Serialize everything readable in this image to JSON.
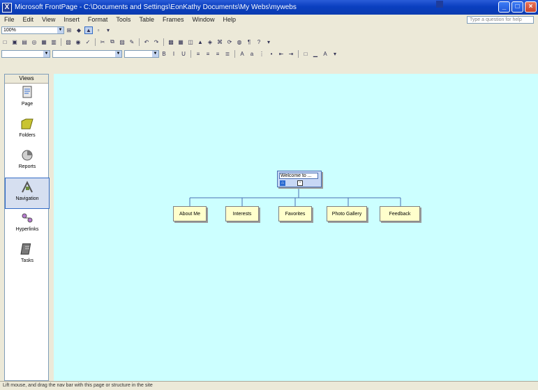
{
  "window": {
    "app_icon": "frontpage-icon",
    "title": "Microsoft FrontPage - C:\\Documents and Settings\\EonKathy Documents\\My Webs\\mywebs"
  },
  "menu": [
    "File",
    "Edit",
    "View",
    "Insert",
    "Format",
    "Tools",
    "Table",
    "Frames",
    "Window",
    "Help"
  ],
  "help_placeholder": "Type a question for help",
  "toolbar": {
    "zoom_value": "100%"
  },
  "views": {
    "header": "Views",
    "items": [
      {
        "label": "Page",
        "icon": "page-view-icon"
      },
      {
        "label": "Folders",
        "icon": "folders-view-icon"
      },
      {
        "label": "Reports",
        "icon": "reports-view-icon"
      },
      {
        "label": "Navigation",
        "icon": "navigation-view-icon"
      },
      {
        "label": "Hyperlinks",
        "icon": "hyperlinks-view-icon"
      },
      {
        "label": "Tasks",
        "icon": "tasks-view-icon"
      }
    ]
  },
  "navigation": {
    "root_label": "Welcome to ...",
    "root_expand_symbol": "-",
    "children": [
      "About Me",
      "Interests",
      "Favorites",
      "Photo Gallery",
      "Feedback"
    ]
  },
  "status": {
    "text": "Lift mouse, and drag the nav bar with this page or structure in the site"
  }
}
